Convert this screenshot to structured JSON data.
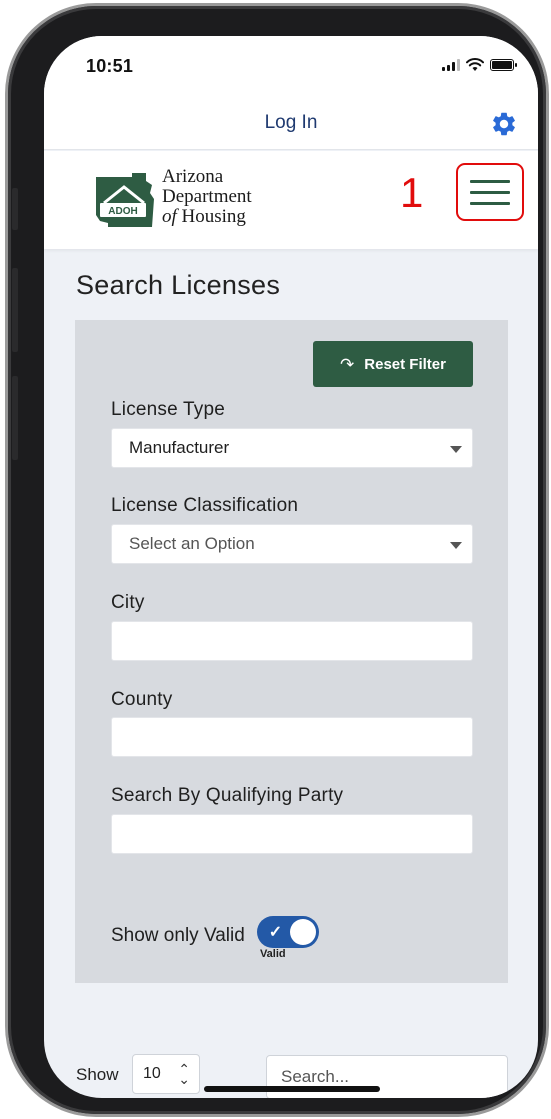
{
  "status_bar": {
    "time": "10:51"
  },
  "header": {
    "login_label": "Log In",
    "settings_icon": "gear-icon"
  },
  "logo": {
    "badge_text": "ADOH",
    "line1": "Arizona",
    "line2": "Department",
    "line3_prefix": "of",
    "line3_rest": " Housing"
  },
  "annotation": {
    "number": "1",
    "color": "#e10c0c"
  },
  "colors": {
    "brand_green": "#2e5c43",
    "toggle_blue": "#2359a7",
    "link_blue": "#1f3a70"
  },
  "main": {
    "title": "Search Licenses",
    "reset_label": "Reset Filter",
    "fields": {
      "license_type": {
        "label": "License Type",
        "value": "Manufacturer"
      },
      "license_classification": {
        "label": "License Classification",
        "value": "Select an Option"
      },
      "city": {
        "label": "City",
        "value": ""
      },
      "county": {
        "label": "County",
        "value": ""
      },
      "qualifying_party": {
        "label": "Search By Qualifying Party",
        "value": ""
      }
    },
    "show_only_valid": {
      "label": "Show only Valid",
      "toggle_caption": "Valid",
      "on": true
    }
  },
  "table_controls": {
    "show_label": "Show",
    "page_size": "10",
    "search_placeholder": "Search..."
  }
}
